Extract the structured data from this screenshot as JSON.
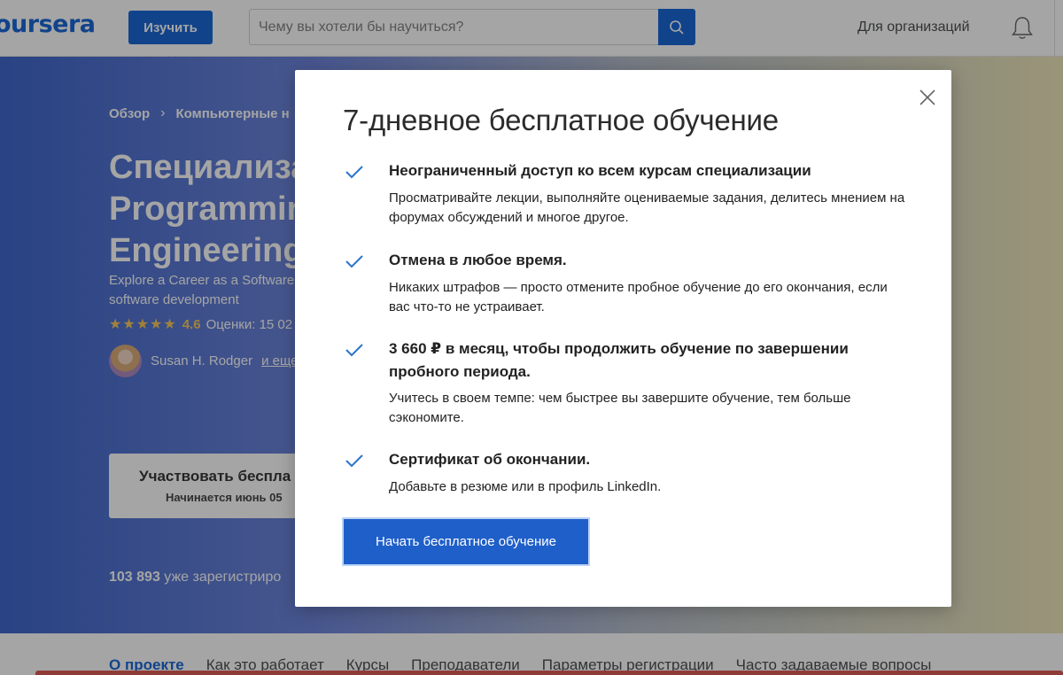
{
  "nav": {
    "logo": "oursera",
    "explore_label": "Изучить",
    "search_placeholder": "Чему вы хотели бы научиться?",
    "for_org_label": "Для организаций"
  },
  "hero": {
    "breadcrumbs": [
      "Обзор",
      "Компьютерные н"
    ],
    "breadcrumb_sep": "›",
    "title_lines": [
      "Специализа",
      "Programmir",
      "Engineering"
    ],
    "subtitle": "Explore a Career as a Software software development",
    "stars": "★★★★★",
    "rating": "4.6",
    "rating_count": "Оценки: 15 02",
    "instructor": "Susan H. Rodger",
    "instructor_more": "и еще",
    "enroll_label": "Участвовать беспла",
    "enroll_sub": "Начинается июнь 05",
    "enrolled_count": "103 893",
    "enrolled_text": "уже зарегистриро"
  },
  "subnav": {
    "items": [
      "О проекте",
      "Как это работает",
      "Курсы",
      "Преподаватели",
      "Параметры регистрации",
      "Часто задаваемые вопросы"
    ]
  },
  "modal": {
    "title": "7-дневное бесплатное обучение",
    "benefits": [
      {
        "title": "Неограниченный доступ ко всем курсам специализации",
        "desc": "Просматривайте лекции, выполняйте оцениваемые задания, делитесь мнением на форумах обсуждений и многое другое."
      },
      {
        "title": "Отмена в любое время.",
        "desc": "Никаких штрафов — просто отмените пробное обучение до его окончания, если вас что-то не устраивает."
      },
      {
        "title": "3 660 ₽ в месяц, чтобы продолжить обучение по завершении пробного периода.",
        "desc": "Учитесь в своем темпе: чем быстрее вы завершите обучение, тем больше сэкономите."
      },
      {
        "title": "Сертификат об окончании.",
        "desc": "Добавьте в резюме или в профиль LinkedIn."
      }
    ],
    "start_label": "Начать бесплатное обучение"
  },
  "colors": {
    "brand_blue": "#0056d2",
    "check_blue": "#2a73cc",
    "star_gold": "#f7c34a"
  },
  "icons": [
    "search-icon",
    "bell-icon",
    "chevron-down-icon",
    "close-icon",
    "check-icon",
    "avatar"
  ]
}
